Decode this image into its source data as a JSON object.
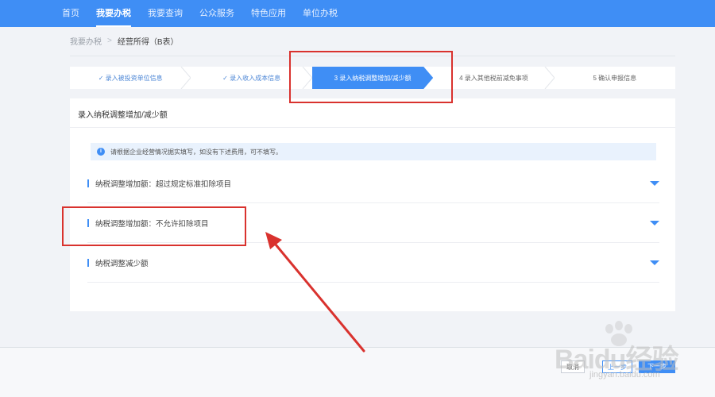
{
  "nav": {
    "items": [
      "首页",
      "我要办税",
      "我要查询",
      "公众服务",
      "特色应用",
      "单位办税"
    ],
    "active_index": 1
  },
  "breadcrumb": {
    "root": "我要办税",
    "current": "经营所得（B表）"
  },
  "steps": [
    {
      "label": "✓ 录入被投资单位信息",
      "state": "done"
    },
    {
      "label": "✓ 录入收入成本信息",
      "state": "done"
    },
    {
      "label": "3 录入纳税调整增加/减少额",
      "state": "active"
    },
    {
      "label": "4 录入其他税前减免事项",
      "state": "todo"
    },
    {
      "label": "5 确认申报信息",
      "state": "todo"
    }
  ],
  "card": {
    "title": "录入纳税调整增加/减少额",
    "notice": "请根据企业经营情况据实填写，如没有下述费用，可不填写。",
    "sections": [
      {
        "label": "纳税调整增加额：超过规定标准扣除项目"
      },
      {
        "label": "纳税调整增加额：不允许扣除项目"
      },
      {
        "label": "纳税调整减少额"
      }
    ]
  },
  "footer": {
    "cancel_label": "取消",
    "prev_label": "上一步",
    "next_label": "下一步"
  },
  "watermark": {
    "text": "Baidu经验",
    "sub": "jingyan.baidu.com"
  },
  "colors": {
    "primary": "#3f8ef5",
    "highlight": "#d9322e",
    "notice_bg": "#e9f2fd"
  },
  "icons": {
    "info": "info-circle-icon",
    "caret": "caret-down-icon",
    "check": "check-icon"
  }
}
